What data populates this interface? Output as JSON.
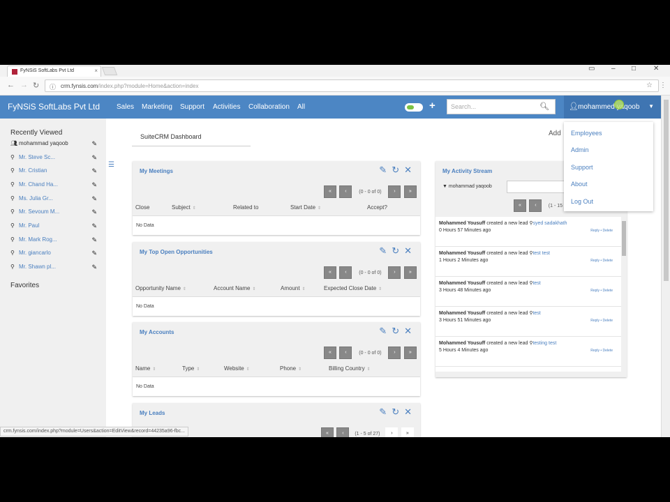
{
  "browser": {
    "tab_title": "FyNSiS SoftLabs Pvt Ltd",
    "url_host": "crm.fynsis.com",
    "url_path": "/index.php?module=Home&action=index"
  },
  "topnav": {
    "brand": "FyNSiS SoftLabs Pvt Ltd",
    "items": [
      "Sales",
      "Marketing",
      "Support",
      "Activities",
      "Collaboration",
      "All"
    ],
    "search_placeholder": "Search...",
    "user_name": "mohammed yaqoob",
    "accent_color": "#4c86c4"
  },
  "user_menu": [
    "Employees",
    "Admin",
    "Support",
    "About",
    "Log Out"
  ],
  "sidebar": {
    "recently_viewed_title": "Recently Viewed",
    "items": [
      {
        "label": "mohammad yaqoob",
        "icon": "users-icon"
      },
      {
        "label": "Mr. Steve Sc...",
        "icon": "lead-icon"
      },
      {
        "label": "Mr. Cristian",
        "icon": "lead-icon"
      },
      {
        "label": "Mr. Chand Ha...",
        "icon": "lead-icon"
      },
      {
        "label": "Ms. Julia Gr...",
        "icon": "lead-icon"
      },
      {
        "label": "Mr. Sevoum M...",
        "icon": "lead-icon"
      },
      {
        "label": "Mr. Paul",
        "icon": "lead-icon"
      },
      {
        "label": "Mr. Mark Rog...",
        "icon": "lead-icon"
      },
      {
        "label": "Mr. giancarlo",
        "icon": "lead-icon"
      },
      {
        "label": "Mr. Shawn pl...",
        "icon": "lead-icon"
      }
    ],
    "favorites_title": "Favorites"
  },
  "dashboard": {
    "tab_label": "SuiteCRM Dashboard",
    "add_label": "Add"
  },
  "dashlets": {
    "meetings": {
      "title": "My Meetings",
      "count": "(0 - 0 of 0)",
      "columns": [
        "Close",
        "Subject",
        "Related to",
        "Start Date",
        "Accept?"
      ],
      "empty": "No Data"
    },
    "opportunities": {
      "title": "My Top Open Opportunities",
      "count": "(0 - 0 of 0)",
      "columns": [
        "Opportunity Name",
        "Account Name",
        "Amount",
        "Expected Close Date"
      ],
      "empty": "No Data"
    },
    "accounts": {
      "title": "My Accounts",
      "count": "(0 - 0 of 0)",
      "columns": [
        "Name",
        "Type",
        "Website",
        "Phone",
        "Billing Country"
      ],
      "empty": "No Data"
    },
    "leads": {
      "title": "My Leads",
      "count": "(1 - 5 of 27)"
    }
  },
  "activity_stream": {
    "title": "My Activity Stream",
    "user": "mohammad yaqoob",
    "count": "(1 - 15",
    "posts": [
      {
        "author": "Mohammed Yousuff",
        "action": "created a new lead",
        "lead": "syed sadakhath",
        "time": "0 Hours 57 Minutes ago",
        "actions": "Reply • Delete"
      },
      {
        "author": "Mohammed Yousuff",
        "action": "created a new lead",
        "lead": "test test",
        "time": "1 Hours 2 Minutes ago",
        "actions": "Reply • Delete"
      },
      {
        "author": "Mohammed Yousuff",
        "action": "created a new lead",
        "lead": "test",
        "time": "3 Hours 48 Minutes ago",
        "actions": "Reply • Delete"
      },
      {
        "author": "Mohammed Yousuff",
        "action": "created a new lead",
        "lead": "test",
        "time": "3 Hours 51 Minutes ago",
        "actions": "Reply • Delete"
      },
      {
        "author": "Mohammed Yousuff",
        "action": "created a new lead",
        "lead": "testing test",
        "time": "5 Hours 4 Minutes ago",
        "actions": "Reply • Delete"
      }
    ]
  },
  "status_url": "crm.fynsis.com/index.php?module=Users&action=EditView&record=44235a96-fbc..."
}
